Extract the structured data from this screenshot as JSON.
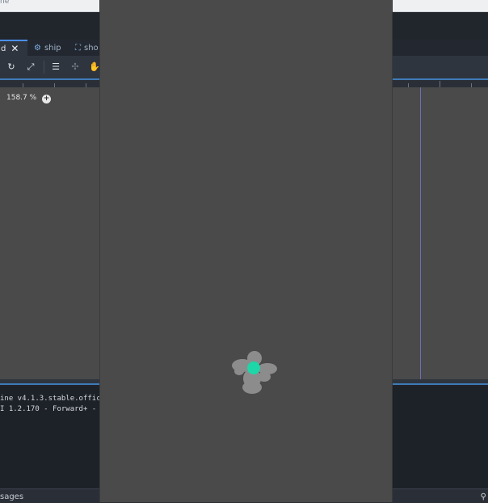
{
  "topbar": {
    "title_fragment": "ne"
  },
  "tabs": [
    {
      "label": "d",
      "active": true,
      "close": "✕"
    },
    {
      "label": "ship",
      "icon": "ship-icon"
    },
    {
      "label": "sho",
      "icon": "scene-icon"
    }
  ],
  "toolbar": {
    "icons": [
      "rotate-icon",
      "scale-icon",
      "list-select-icon",
      "pivot-icon",
      "pan-hand-icon"
    ]
  },
  "viewport": {
    "zoom_label": "158.7 %",
    "zoom_plus": "+"
  },
  "output": {
    "lines": [
      "ine v4.1.3.stable.offic",
      "I 1.2.170 - Forward+ -"
    ]
  },
  "bottom": {
    "label": "sages",
    "search_icon": "magnifier-icon"
  },
  "game": {
    "ship_color": "#8c8c8c",
    "core_color": "#1ed6a8",
    "background": "#4a4a4a"
  }
}
